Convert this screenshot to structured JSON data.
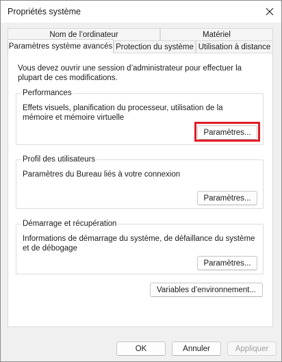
{
  "window": {
    "title": "Propriétés système",
    "close_icon": "close-icon"
  },
  "tabs": {
    "row1": [
      {
        "label": "Nom de l’ordinateur"
      },
      {
        "label": "Matériel"
      }
    ],
    "row2": [
      {
        "label": "Paramètres système avancés",
        "active": true
      },
      {
        "label": "Protection du système"
      },
      {
        "label": "Utilisation à distance"
      }
    ]
  },
  "panel": {
    "intro": "Vous devez ouvrir une session d’administrateur pour effectuer la plupart de ces modifications.",
    "performances": {
      "title": "Performances",
      "text": "Effets visuels, planification du processeur, utilisation de la mémoire et mémoire virtuelle",
      "button": "Paramètres..."
    },
    "profil": {
      "title": "Profil des utilisateurs",
      "text": "Paramètres du Bureau liés à votre connexion",
      "button": "Paramètres..."
    },
    "demarrage": {
      "title": "Démarrage et récupération",
      "text": "Informations de démarrage du système, de défaillance du système et de débogage",
      "button": "Paramètres..."
    },
    "env_button": "Variables d’environnement..."
  },
  "footer": {
    "ok": "OK",
    "cancel": "Annuler",
    "apply": "Appliquer",
    "apply_disabled": true
  },
  "colors": {
    "highlight": "#e01b24"
  }
}
